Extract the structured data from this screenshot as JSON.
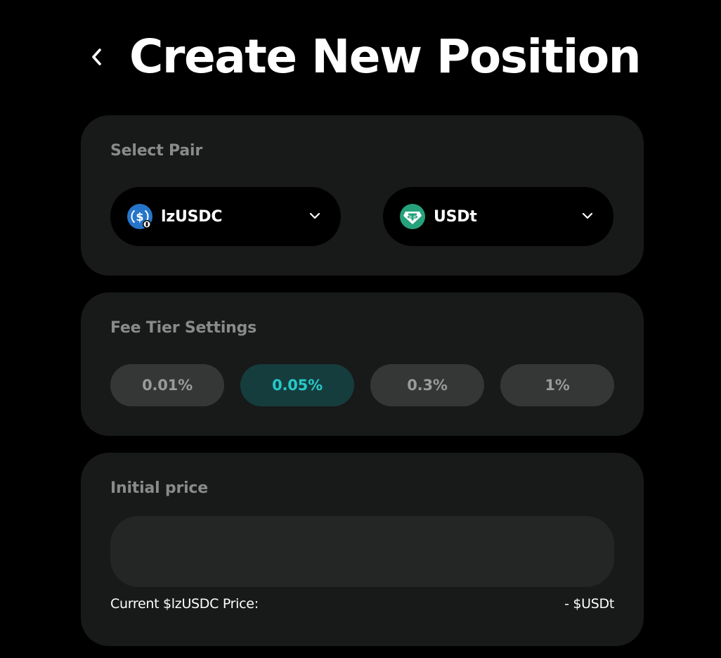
{
  "header": {
    "title": "Create New Position",
    "back_icon": "chevron-left-icon"
  },
  "pair": {
    "label": "Select Pair",
    "token_a": {
      "symbol": "lzUSDC",
      "icon": "usdc-token-icon",
      "color": "#2775ca"
    },
    "token_b": {
      "symbol": "USDt",
      "icon": "tether-token-icon",
      "color": "#26a17b"
    }
  },
  "fee_tier": {
    "label": "Fee Tier Settings",
    "options": [
      "0.01%",
      "0.05%",
      "0.3%",
      "1%"
    ],
    "selected": "0.05%",
    "active_color": "#26c9cb"
  },
  "initial_price": {
    "label": "Initial price",
    "input_value": "",
    "current_label": "Current $lzUSDC Price:",
    "current_value": "- $USDt"
  }
}
